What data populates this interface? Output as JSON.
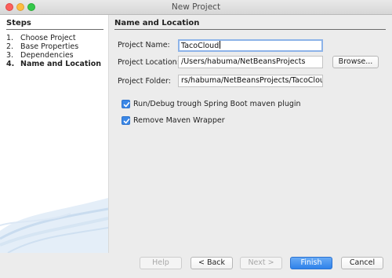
{
  "window": {
    "title": "New Project"
  },
  "steps": {
    "header": "Steps",
    "items": [
      {
        "num": "1.",
        "label": "Choose Project"
      },
      {
        "num": "2.",
        "label": "Base Properties"
      },
      {
        "num": "3.",
        "label": "Dependencies"
      },
      {
        "num": "4.",
        "label": "Name and Location",
        "current": true
      }
    ]
  },
  "form": {
    "header": "Name and Location",
    "project_name_label": "Project Name:",
    "project_name_value": "TacoCloud",
    "project_location_label": "Project Location:",
    "project_location_value": "/Users/habuma/NetBeansProjects",
    "browse_label": "Browse...",
    "project_folder_label": "Project Folder:",
    "project_folder_value": "rs/habuma/NetBeansProjects/TacoCloud",
    "run_debug_label": "Run/Debug trough Spring Boot maven plugin",
    "run_debug_checked": true,
    "remove_wrapper_label": "Remove Maven Wrapper",
    "remove_wrapper_checked": true
  },
  "buttons": {
    "help": "Help",
    "back": "< Back",
    "next": "Next >",
    "finish": "Finish",
    "cancel": "Cancel"
  },
  "colors": {
    "accent": "#3b87e6",
    "primary_button": "#2f82ea",
    "close": "#fc605c",
    "minimize": "#fdbc40",
    "zoom": "#34c84a"
  },
  "icons": [
    "close-window-icon",
    "minimize-window-icon",
    "zoom-window-icon",
    "checkmark-icon"
  ]
}
